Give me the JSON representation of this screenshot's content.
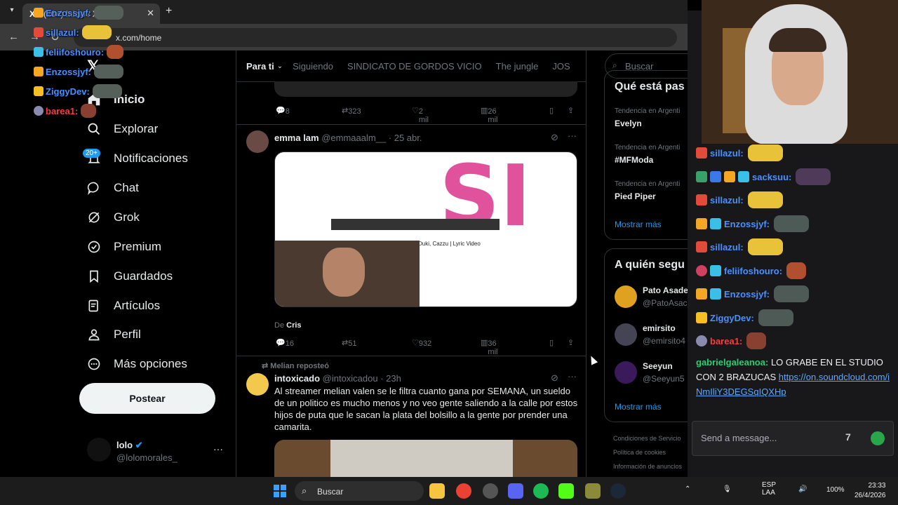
{
  "browser": {
    "tab_title": "(20+) Inicio / X",
    "address": "x.com/home"
  },
  "x_nav": {
    "logo": "𝕏",
    "items": [
      {
        "label": "Inicio"
      },
      {
        "label": "Explorar"
      },
      {
        "label": "Notificaciones",
        "badge": "20+"
      },
      {
        "label": "Chat"
      },
      {
        "label": "Grok"
      },
      {
        "label": "Premium"
      },
      {
        "label": "Guardados"
      },
      {
        "label": "Artículos"
      },
      {
        "label": "Perfil"
      },
      {
        "label": "Más opciones"
      }
    ],
    "post_button": "Postear",
    "account": {
      "name": "lolo",
      "handle": "@lolomorales_",
      "more": "···"
    }
  },
  "feed": {
    "tabs": [
      "Para ti",
      "Siguiendo",
      "SINDICATO DE GORDOS VICIO",
      "The jungle",
      "JOS"
    ],
    "tweet0_actions": {
      "replies": "8",
      "reposts": "323",
      "likes": "2 mil",
      "views": "26 mil"
    },
    "tweet1": {
      "name": "emma lam",
      "handle_time": "@emmaaalm__ · 25 abr.",
      "video_title": "Duki, Cazzu | Lyric Video",
      "from_prefix": "De",
      "from_name": "Cris",
      "replies": "16",
      "reposts": "51",
      "likes": "932",
      "views": "36 mil"
    },
    "tweet2": {
      "repost_by": "Melian reposteó",
      "name": "intoxicado",
      "handle_time": "@intoxicadou · 23h",
      "text": "Al streamer melian valen se le filtra cuanto gana por SEMANA, un sueldo de un politico es mucho menos y no veo gente saliendo a la calle por estos hijos de puta que le sacan la plata del bolsillo a la gente por prender una camarita."
    }
  },
  "sidebar": {
    "search_placeholder": "Buscar",
    "trends_title": "Qué está pas",
    "trends": [
      {
        "context": "Tendencia en Argenti",
        "name": "Evelyn"
      },
      {
        "context": "Tendencia en Argenti",
        "name": "#MFModa"
      },
      {
        "context": "Tendencia en Argenti",
        "name": "Pied Piper"
      }
    ],
    "show_more": "Mostrar más",
    "follow_title": "A quién segu",
    "follow": [
      {
        "name": "Pato Asade",
        "handle": "@PatoAsac"
      },
      {
        "name": "emirsito",
        "handle": "@emirsito4"
      },
      {
        "name": "Seeyun",
        "handle": "@Seeyun5"
      }
    ],
    "follow_more": "Mostrar más",
    "footer": [
      "Condiciones de Servicio",
      "Política de cookies",
      "Información de anuncios"
    ]
  },
  "overlay_chat": [
    {
      "user": "Enzossjyf:",
      "color": "#4a90ff"
    },
    {
      "user": "sillazul:",
      "color": "#4a90ff"
    },
    {
      "user": "feliifoshouro:",
      "color": "#4a90ff"
    },
    {
      "user": "Enzossjyf:",
      "color": "#4a90ff"
    },
    {
      "user": "ZiggyDev:",
      "color": "#4a90ff"
    },
    {
      "user": "barea1:",
      "color": "#ff3b3b"
    }
  ],
  "stream_chat": {
    "lines": [
      {
        "user": "sillazul:",
        "color": "#4a90ff"
      },
      {
        "user": "sacksuu:",
        "color": "#4a90ff"
      },
      {
        "user": "sillazul:",
        "color": "#4a90ff"
      },
      {
        "user": "Enzossjyf:",
        "color": "#4a90ff"
      },
      {
        "user": "sillazul:",
        "color": "#4a90ff"
      },
      {
        "user": "feliifoshouro:",
        "color": "#4a90ff"
      },
      {
        "user": "Enzossjyf:",
        "color": "#4a90ff"
      },
      {
        "user": "ZiggyDev:",
        "color": "#4a90ff"
      },
      {
        "user": "barea1:",
        "color": "#ff3b3b"
      }
    ],
    "last_user": "gabrielgaleanoa:",
    "last_text": "LO GRABE EN EL STUDIO CON 2 BRAZUCAS",
    "last_link": "https://on.soundcloud.com/iNmIliY3DEGSqIQXHp",
    "input_placeholder": "Send a message..."
  },
  "taskbar": {
    "search": "Buscar",
    "lang": "ESP",
    "lang2": "LAA",
    "battery": "100%",
    "time": "23:33",
    "date": "26/4/2026"
  }
}
